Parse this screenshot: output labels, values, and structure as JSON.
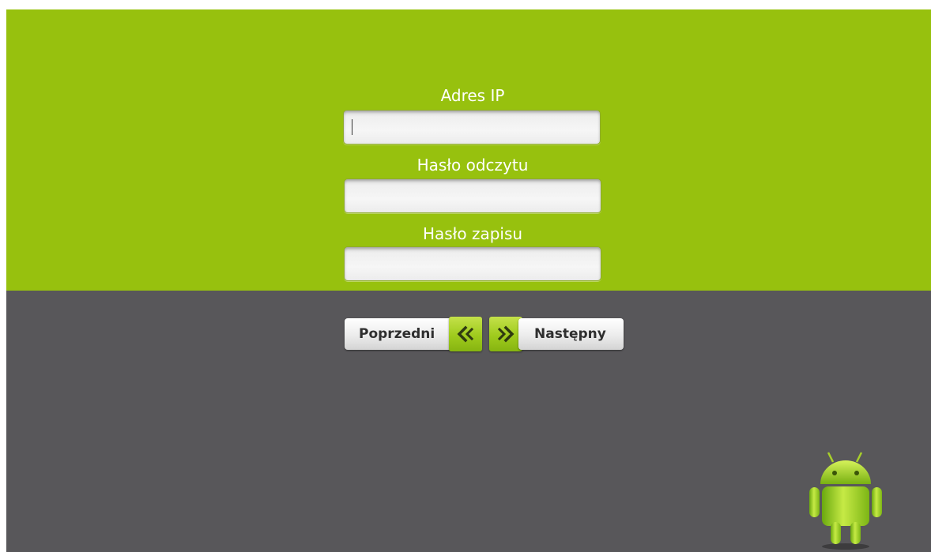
{
  "form": {
    "ip_label": "Adres IP",
    "ip_value": "",
    "read_password_label": "Hasło odczytu",
    "read_password_value": "",
    "write_password_label": "Hasło zapisu",
    "write_password_value": ""
  },
  "navigation": {
    "prev_label": "Poprzedni",
    "next_label": "Następny"
  },
  "icons": {
    "prev": "double-chevron-left-icon",
    "next": "double-chevron-right-icon",
    "logo": "android-robot-icon"
  },
  "colors": {
    "top_panel": "#97c10e",
    "bottom_panel": "#58575a",
    "accent": "#9fcb1d"
  }
}
